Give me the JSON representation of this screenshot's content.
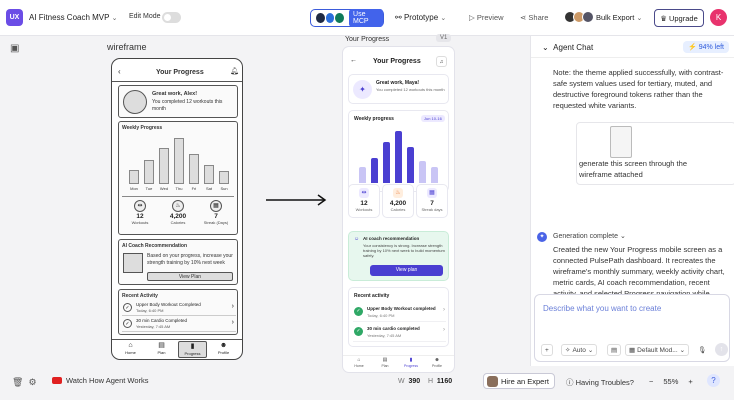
{
  "topbar": {
    "logo": "UX",
    "app_title": "AI Fitness Coach MVP",
    "edit_mode": "Edit Mode",
    "mcp_label": "Use MCP",
    "prototype": "Prototype",
    "preview": "Preview",
    "share": "Share",
    "bulk_export": "Bulk Export",
    "upgrade": "Upgrade",
    "user_initial": "K"
  },
  "canvas": {
    "wireframe_label": "wireframe",
    "screen_label": "Your Progress",
    "version": "V1",
    "width_label": "W",
    "width": "390",
    "height_label": "H",
    "height": "1160"
  },
  "wireframe": {
    "title": "Your Progress",
    "greeting": "Great work, Alex!",
    "summary": "You completed 12 workouts this month",
    "weekly_title": "Weekly Progress",
    "days": [
      "Mon",
      "Tue",
      "Wed",
      "Thu",
      "Fri",
      "Sat",
      "Sun"
    ],
    "stats": [
      {
        "value": "12",
        "label": "Workouts"
      },
      {
        "value": "4,200",
        "label": "Calories"
      },
      {
        "value": "7",
        "label": "Streak (Days)"
      }
    ],
    "ai_title": "AI Coach Recommendation",
    "ai_text": "Based on your progress, increase your strength training by 10% next week",
    "ai_button": "View Plan",
    "recent_title": "Recent Activity",
    "activities": [
      {
        "name": "Upper Body Workout Completed",
        "time": "Today, 6:40 PM"
      },
      {
        "name": "30 min Cardio Completed",
        "time": "Yesterday, 7:45 AM"
      }
    ],
    "nav": [
      "Home",
      "Plan",
      "Progress",
      "Profile"
    ]
  },
  "phone": {
    "title": "Your Progress",
    "greeting": "Great work, Maya!",
    "summary": "You completed 12 workouts this month",
    "weekly_title": "Weekly progress",
    "date_badge": "Jun 10-16",
    "stats": [
      {
        "value": "12",
        "label": "Workouts"
      },
      {
        "value": "4,200",
        "label": "Calories"
      },
      {
        "value": "7",
        "label": "Streak days"
      }
    ],
    "ai_title": "AI coach recommendation",
    "ai_text": "Your consistency is strong. Increase strength training by 10% next week to build momentum safely.",
    "ai_button": "View plan",
    "recent_title": "Recent activity",
    "activities": [
      {
        "name": "Upper Body Workout completed",
        "time": "Today, 6:40 PM"
      },
      {
        "name": "30 min cardio completed",
        "time": "Yesterday, 7:45 AM"
      }
    ],
    "nav": [
      "Home",
      "Plan",
      "Progress",
      "Profile"
    ]
  },
  "agent": {
    "title": "Agent Chat",
    "credits": "94% left",
    "note": "Note: the theme applied successfully, with contrast-safe system values used for tertiary, muted, and destructive foreground tokens rather than the requested white variants.",
    "prompt": "generate this screen through the wireframe attached",
    "gen_status": "Generation complete",
    "result": "Created the new Your Progress mobile screen as a connected PulsePath dashboard. It recreates the wireframe's monthly summary, weekly activity chart, metric cards, AI coach recommendation, recent activity, and selected Progress navigation while applying the existing Premium Indigo wellness-tech styling.",
    "input_placeholder": "Describe what you want to create",
    "auto": "Auto",
    "model": "Default Mod...",
    "hire": "Hire an Expert",
    "trouble": "Having Troubles?",
    "zoom": "55%"
  },
  "footer": {
    "watch": "Watch How Agent Works"
  },
  "colors": {
    "accent": "#4a3fd1",
    "brand": "#6b4de6",
    "green": "#2fa866"
  }
}
